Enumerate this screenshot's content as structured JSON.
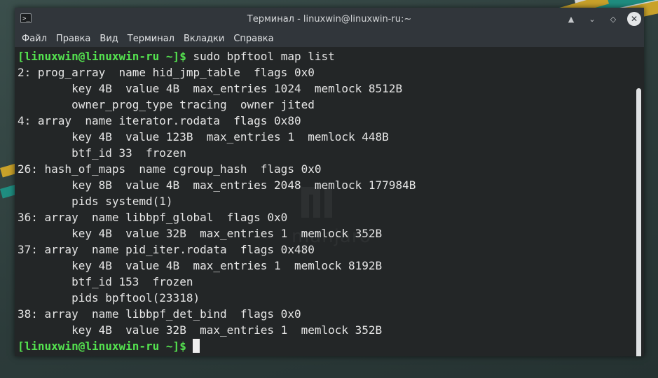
{
  "window": {
    "title": "Терминал - linuxwin@linuxwin-ru:~",
    "app_icon_glyph": ">_",
    "buttons": {
      "keep_above": "▲",
      "minimize": "⌄",
      "maximize": "◇",
      "close": "✕"
    }
  },
  "menu": [
    "Файл",
    "Правка",
    "Вид",
    "Терминал",
    "Вкладки",
    "Справка"
  ],
  "watermark": "manjaro",
  "terminal": {
    "prompt": "[linuxwin@linuxwin-ru ~]$",
    "command": " sudo bpftool map list",
    "output": [
      "2: prog_array  name hid_jmp_table  flags 0x0",
      "        key 4B  value 4B  max_entries 1024  memlock 8512B",
      "        owner_prog_type tracing  owner jited",
      "4: array  name iterator.rodata  flags 0x80",
      "        key 4B  value 123B  max_entries 1  memlock 448B",
      "        btf_id 33  frozen",
      "26: hash_of_maps  name cgroup_hash  flags 0x0",
      "        key 8B  value 4B  max_entries 2048  memlock 177984B",
      "        pids systemd(1)",
      "36: array  name libbpf_global  flags 0x0",
      "        key 4B  value 32B  max_entries 1  memlock 352B",
      "37: array  name pid_iter.rodata  flags 0x480",
      "        key 4B  value 4B  max_entries 1  memlock 8192B",
      "        btf_id 153  frozen",
      "        pids bpftool(23318)",
      "38: array  name libbpf_det_bind  flags 0x0",
      "        key 4B  value 32B  max_entries 1  memlock 352B"
    ],
    "final_prompt": "[linuxwin@linuxwin-ru ~]$"
  }
}
